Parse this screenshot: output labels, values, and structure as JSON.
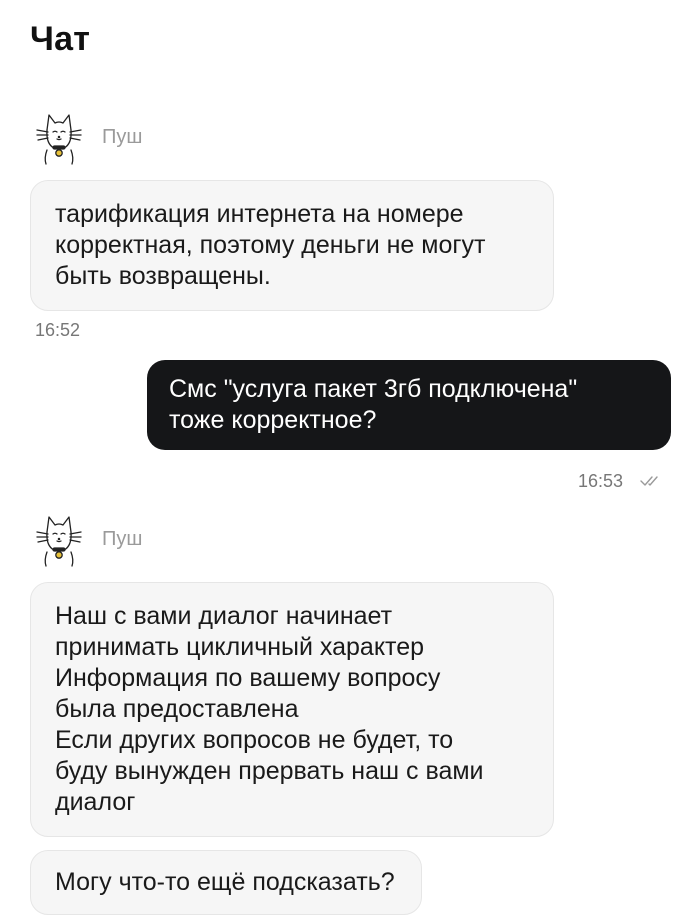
{
  "page": {
    "title": "Чат"
  },
  "messages": [
    {
      "sender": "Пуш",
      "lines": [
        "тарификация интернета на номере",
        "корректная, поэтому деньги не могут",
        "быть возвращены."
      ],
      "time": "16:52"
    },
    {
      "lines": [
        "Смс \"услуга пакет 3гб подключена\"",
        "тоже корректное?"
      ],
      "time": "16:53",
      "status_icon": "double-check-icon"
    },
    {
      "sender": "Пуш",
      "lines": [
        "Наш с вами диалог начинает",
        "принимать цикличный характер",
        "Информация по вашему вопросу",
        "была предоставлена",
        "Если других вопросов не будет, то",
        "буду вынужден прервать наш с вами",
        "диалог"
      ]
    },
    {
      "lines": [
        "Могу что-то ещё подсказать?"
      ]
    }
  ],
  "icons": {
    "avatar": "cat-avatar-icon",
    "read_status": "double-check-icon"
  },
  "colors": {
    "outgoing_bubble": "#151618",
    "incoming_bubble": "#f6f6f6",
    "muted_text": "#9a9a9a"
  }
}
